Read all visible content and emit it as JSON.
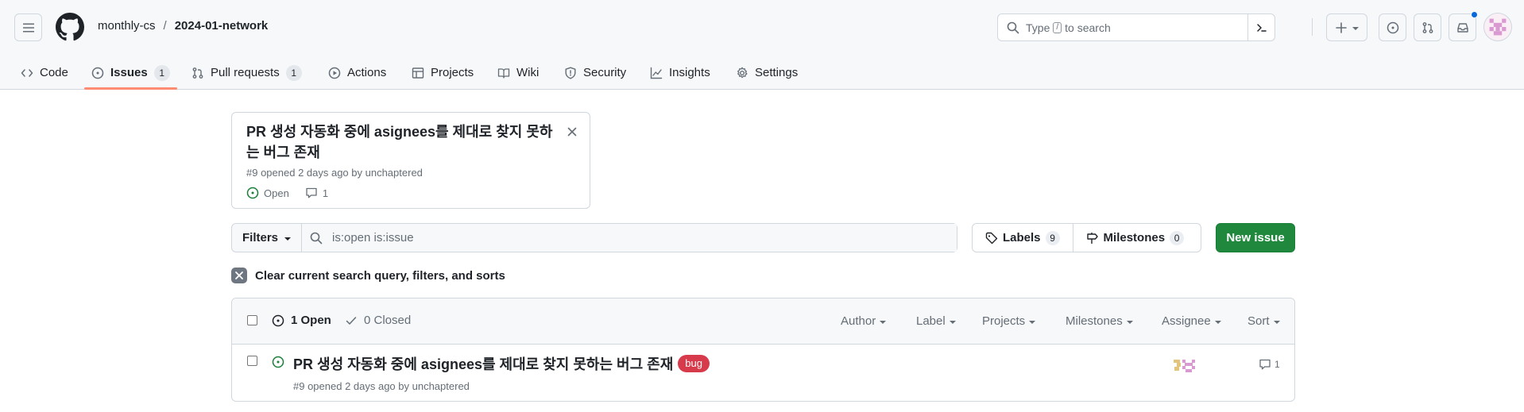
{
  "header": {
    "owner": "monthly-cs",
    "separator": "/",
    "repo": "2024-01-network",
    "search_placeholder_pre": "Type",
    "search_key": "/",
    "search_placeholder_post": "to search"
  },
  "repo_nav": {
    "tabs": [
      {
        "label": "Code",
        "icon": "code-icon"
      },
      {
        "label": "Issues",
        "icon": "issue-opened-icon",
        "count": "1",
        "selected": true
      },
      {
        "label": "Pull requests",
        "icon": "git-pull-request-icon",
        "count": "1"
      },
      {
        "label": "Actions",
        "icon": "play-icon"
      },
      {
        "label": "Projects",
        "icon": "table-icon"
      },
      {
        "label": "Wiki",
        "icon": "book-icon"
      },
      {
        "label": "Security",
        "icon": "shield-icon"
      },
      {
        "label": "Insights",
        "icon": "graph-icon"
      },
      {
        "label": "Settings",
        "icon": "gear-icon"
      }
    ]
  },
  "pinned_issue": {
    "title": "PR 생성 자동화 중에 asignees를 제대로 찾지 못하는 버그 존재",
    "meta": "#9 opened 2 days ago by unchaptered",
    "state": "Open",
    "comments": "1"
  },
  "filter_bar": {
    "filters_label": "Filters",
    "query": "is:open is:issue",
    "labels_label": "Labels",
    "labels_count": "9",
    "milestones_label": "Milestones",
    "milestones_count": "0",
    "new_issue_label": "New issue",
    "clear_label": "Clear current search query, filters, and sorts"
  },
  "issue_list": {
    "open_label": "1 Open",
    "closed_label": "0 Closed",
    "header_filters": [
      "Author",
      "Label",
      "Projects",
      "Milestones",
      "Assignee",
      "Sort"
    ],
    "issues": [
      {
        "title": "PR 생성 자동화 중에 asignees를 제대로 찾지 못하는 버그 존재",
        "label": "bug",
        "meta": "#9 opened 2 days ago by unchaptered",
        "comments": "1"
      }
    ]
  },
  "colors": {
    "accent_green": "#1f883d",
    "open_green": "#1a7f37",
    "bug_red": "#d73a4a",
    "tab_underline": "#fd8c73",
    "notification_blue": "#0969da"
  }
}
